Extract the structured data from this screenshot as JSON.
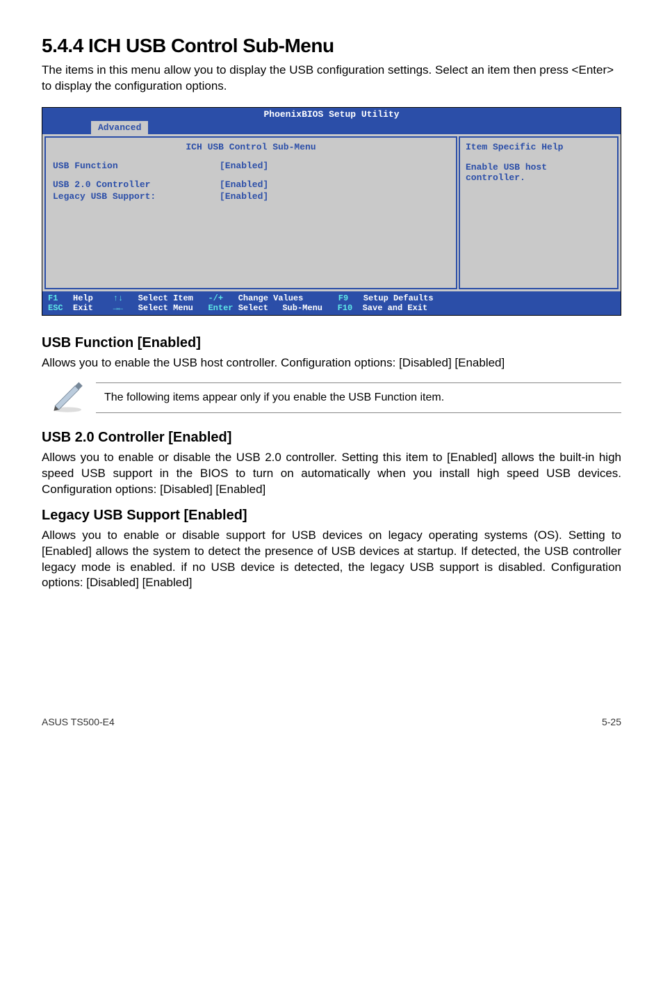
{
  "section": {
    "number_title": "5.4.4 ICH USB Control Sub-Menu",
    "intro": "The items in this menu allow you to display the USB configuration settings. Select an item then press <Enter> to display the configuration options."
  },
  "bios": {
    "title": "PhoenixBIOS Setup Utility",
    "tab": "Advanced",
    "panel_title": "ICH USB Control Sub-Menu",
    "help_title": "Item Specific Help",
    "help_text": "Enable USB host controller.",
    "rows": [
      {
        "label": "USB Function",
        "value": "[Enabled]"
      },
      {
        "label": "USB 2.0 Controller",
        "value": "[Enabled]"
      },
      {
        "label": "Legacy USB Support:",
        "value": "[Enabled]"
      }
    ],
    "footer": {
      "f1": "F1",
      "esc": "ESC",
      "help": "Help",
      "exit": "Exit",
      "updown": "↑↓",
      "leftright": "→←",
      "select_item": "Select Item",
      "select_menu": "Select Menu",
      "minusplus": "-/+",
      "enter": "Enter",
      "change_values": "Change Values",
      "select_submenu_pre": "Select ",
      "select_submenu_post": " Sub-Menu",
      "f9": "F9",
      "f10": "F10",
      "setup_defaults": "Setup Defaults",
      "save_exit": "Save and Exit"
    }
  },
  "subsections": [
    {
      "heading": "USB Function [Enabled]",
      "body": "Allows you to enable the USB host controller. Configuration options: [Disabled] [Enabled]"
    }
  ],
  "note": "The following items appear only if you enable the USB Function item.",
  "subsections2": [
    {
      "heading": "USB 2.0 Controller [Enabled]",
      "body": "Allows you to enable or disable the USB 2.0 controller. Setting this item to [Enabled] allows the built-in high speed USB support in the BIOS to turn on automatically when you install high speed USB devices. Configuration options: [Disabled] [Enabled]"
    },
    {
      "heading": "Legacy USB Support [Enabled]",
      "body": "Allows you to enable or disable support for USB devices on legacy operating systems (OS). Setting to [Enabled] allows the system to detect the presence of USB devices at startup. If detected, the USB controller legacy mode is enabled. if no USB device is detected, the legacy USB support is disabled. Configuration options: [Disabled] [Enabled]"
    }
  ],
  "footer": {
    "left": "ASUS TS500-E4",
    "right": "5-25"
  }
}
